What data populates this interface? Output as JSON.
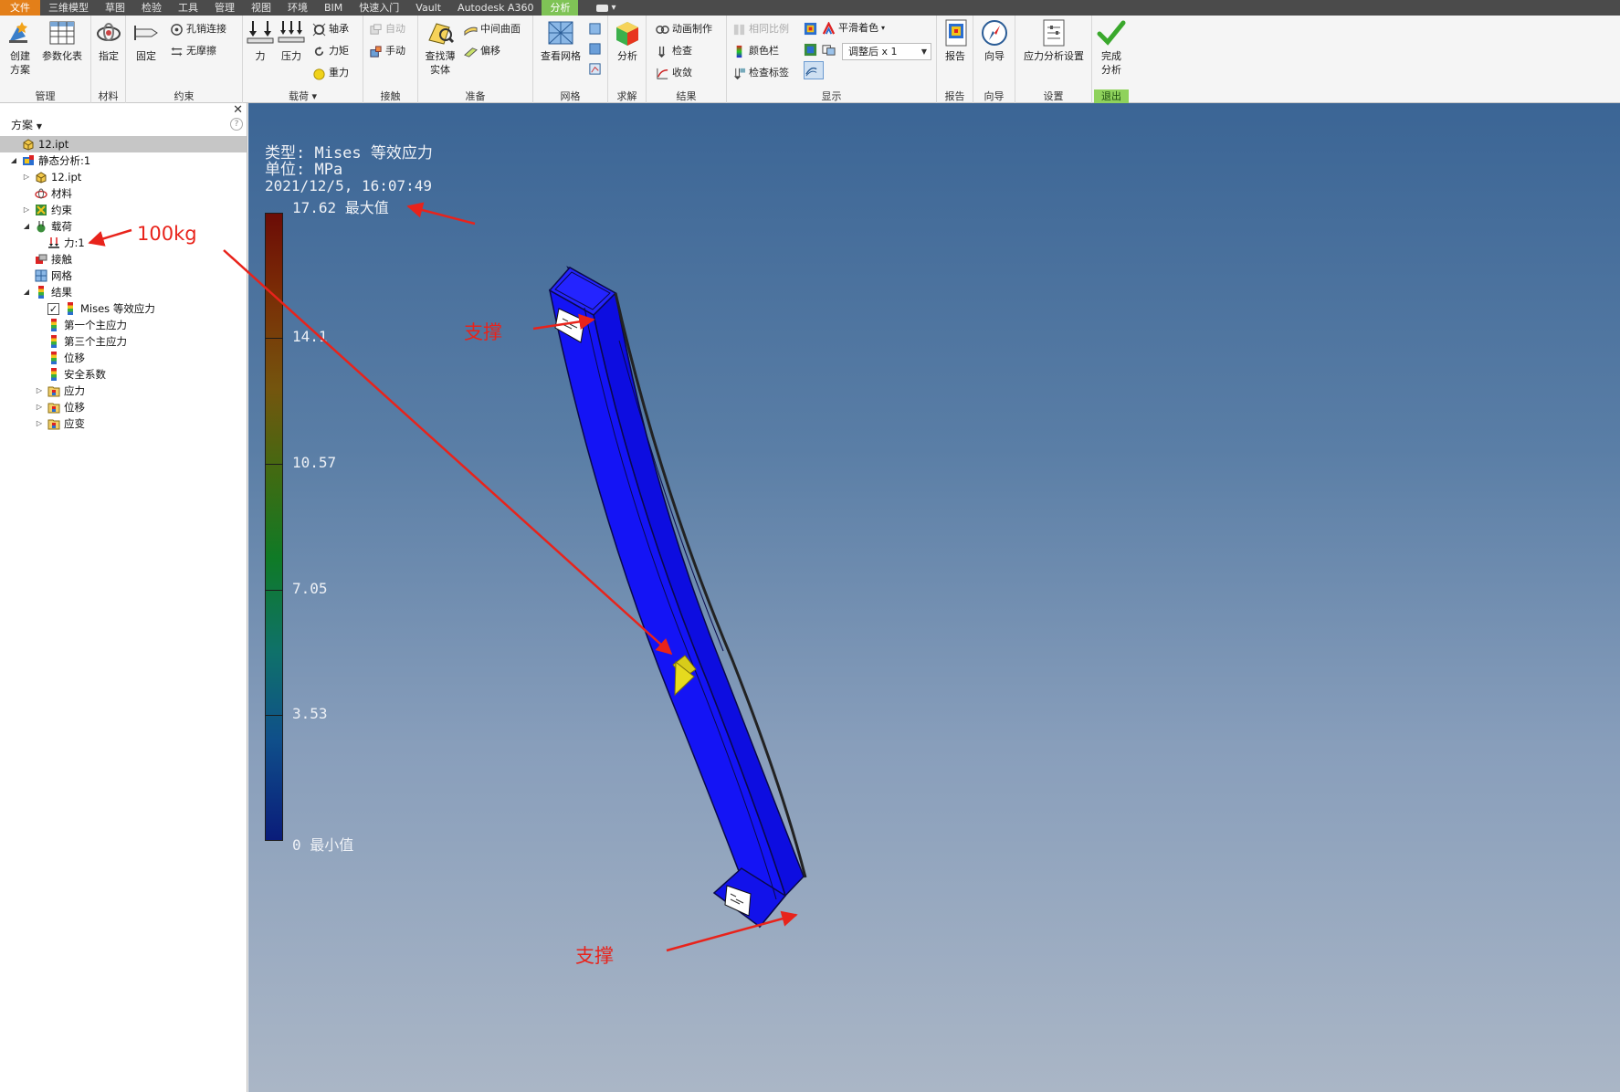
{
  "menubar": {
    "tabs": [
      "文件",
      "三维模型",
      "草图",
      "检验",
      "工具",
      "管理",
      "视图",
      "环境",
      "BIM",
      "快速入门",
      "Vault",
      "Autodesk A360",
      "分析"
    ],
    "active_tab": "分析",
    "extra": "▾"
  },
  "ribbon": {
    "manage": {
      "title": "管理",
      "create_plan": "创建\n方案",
      "param_table": "参数化表"
    },
    "material": {
      "title": "材料",
      "assign": "指定"
    },
    "constraint": {
      "title": "约束",
      "fixed": "固定",
      "pin": "孔销连接",
      "frictionless": "无摩擦"
    },
    "load": {
      "title": "载荷",
      "force": "力",
      "pressure": "压力",
      "bearing": "轴承",
      "moment": "力矩",
      "gravity": "重力"
    },
    "contact": {
      "title": "接触",
      "auto": "自动",
      "manual": "手动"
    },
    "prepare": {
      "title": "准备",
      "find_thin": "查找薄\n实体",
      "mid_surface": "中间曲面",
      "offset": "偏移"
    },
    "mesh": {
      "title": "网格",
      "view_mesh": "查看网格"
    },
    "solve": {
      "title": "求解",
      "analyze": "分析"
    },
    "result": {
      "title": "结果",
      "animate": "动画制作",
      "probe": "检查",
      "converge": "收敛"
    },
    "display": {
      "title": "显示",
      "same_scale": "相同比例",
      "color_bar": "颜色栏",
      "probe_labels": "检查标签",
      "smooth_shading": "平滑着色",
      "adjusted": "调整后 x 1"
    },
    "report": {
      "title": "报告",
      "report": "报告"
    },
    "guide": {
      "title": "向导",
      "guide": "向导"
    },
    "settings": {
      "title": "设置",
      "stress_settings": "应力分析设置"
    },
    "exit": {
      "title": "退出",
      "finish": "完成\n分析"
    }
  },
  "browser": {
    "header": "方案",
    "help": "?",
    "close": "✕",
    "tree": [
      {
        "label": "12.ipt",
        "level": 0,
        "exp": "",
        "icon": "part",
        "selected": true
      },
      {
        "label": "静态分析:1",
        "level": 0,
        "exp": "◢",
        "icon": "study"
      },
      {
        "label": "12.ipt",
        "level": 1,
        "exp": "▷",
        "icon": "part"
      },
      {
        "label": "材料",
        "level": 1,
        "exp": "",
        "icon": "material"
      },
      {
        "label": "约束",
        "level": 1,
        "exp": "▷",
        "icon": "constraint"
      },
      {
        "label": "载荷",
        "level": 1,
        "exp": "◢",
        "icon": "load"
      },
      {
        "label": "力:1",
        "level": 2,
        "exp": "",
        "icon": "force"
      },
      {
        "label": "接触",
        "level": 1,
        "exp": "",
        "icon": "contact"
      },
      {
        "label": "网格",
        "level": 1,
        "exp": "",
        "icon": "mesh"
      },
      {
        "label": "结果",
        "level": 1,
        "exp": "◢",
        "icon": "result"
      },
      {
        "label": "Mises 等效应力",
        "level": 2,
        "exp": "",
        "icon": "result",
        "checkbox": true
      },
      {
        "label": "第一个主应力",
        "level": 2,
        "exp": "",
        "icon": "result"
      },
      {
        "label": "第三个主应力",
        "level": 2,
        "exp": "",
        "icon": "result"
      },
      {
        "label": "位移",
        "level": 2,
        "exp": "",
        "icon": "result"
      },
      {
        "label": "安全系数",
        "level": 2,
        "exp": "",
        "icon": "result"
      },
      {
        "label": "应力",
        "level": 2,
        "exp": "▷",
        "icon": "folder"
      },
      {
        "label": "位移",
        "level": 2,
        "exp": "▷",
        "icon": "folder"
      },
      {
        "label": "应变",
        "level": 2,
        "exp": "▷",
        "icon": "folder"
      }
    ]
  },
  "viewport": {
    "type_line": "类型: Mises 等效应力",
    "unit_line": "单位: MPa",
    "timestamp": "2021/12/5, 16:07:49",
    "legend": {
      "max_label": "17.62 最大值",
      "min_label": "0 最小值",
      "ticks": [
        "14.1",
        "10.57",
        "7.05",
        "3.53"
      ],
      "max_value": 17.62,
      "min_value": 0
    }
  },
  "annotations": {
    "load": "100kg",
    "support_top": "支撑",
    "support_bottom": "支撑"
  },
  "colors": {
    "beam": "#1010f2",
    "annotation": "#e8231b",
    "active_tab": "#7fc356",
    "file_tab": "#e37f19"
  }
}
